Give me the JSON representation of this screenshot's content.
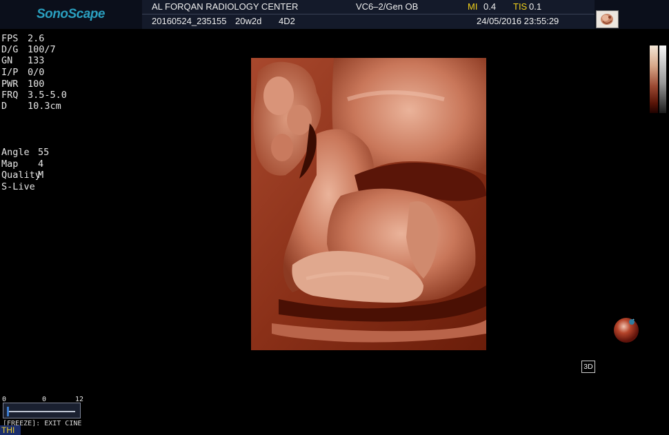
{
  "header": {
    "logo": "SonoScape",
    "center_name": "AL FORQAN  RADIOLOGY CENTER",
    "probe_preset": "VC6–2/Gen OB",
    "mi_label": "MI",
    "mi_value": "0.4",
    "tis_label": "TIS",
    "tis_value": "0.1",
    "patient_id": "20160524_235155",
    "gestational_age": "20w2d",
    "mode": "4D2",
    "datetime": "24/05/2016 23:55:29"
  },
  "params": [
    {
      "label": "FPS",
      "value": "2.6"
    },
    {
      "label": "D/G",
      "value": "100/7"
    },
    {
      "label": "GN",
      "value": "133"
    },
    {
      "label": "I/P",
      "value": "0/0"
    },
    {
      "label": "PWR",
      "value": "100"
    },
    {
      "label": "FRQ",
      "value": "3.5-5.0"
    },
    {
      "label": "D",
      "value": "10.3cm"
    }
  ],
  "render_params": [
    {
      "label": "Angle",
      "value": "55"
    },
    {
      "label": "Map",
      "value": "4"
    },
    {
      "label": "Quality",
      "value": "M"
    },
    {
      "label": "S-Live",
      "value": ""
    }
  ],
  "mode_badge": "3D",
  "cine": {
    "start_label": "0",
    "current_label": "0",
    "end_label": "12",
    "status_text": "[FREEZE]: EXIT CINE"
  },
  "thi_label": "THI",
  "colors": {
    "logo": "#2a9fbf",
    "warning_label": "#f3d21a",
    "header_panel": "#141a2a",
    "tissue_dark": "#5a1508",
    "tissue_light": "#e2a489"
  },
  "icons": {
    "thumbnail": "fetus-thumbnail-icon",
    "orientation": "orientation-sphere-icon"
  }
}
